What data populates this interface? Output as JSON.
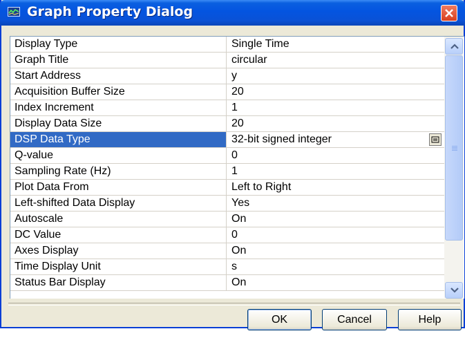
{
  "window": {
    "title": "Graph Property Dialog",
    "close_icon": "close-icon"
  },
  "properties": [
    {
      "name": "Display Type",
      "value": "Single Time"
    },
    {
      "name": "Graph Title",
      "value": "circular"
    },
    {
      "name": "Start Address",
      "value": "y"
    },
    {
      "name": "Acquisition Buffer Size",
      "value": "20"
    },
    {
      "name": "Index Increment",
      "value": "1"
    },
    {
      "name": "Display Data Size",
      "value": "20"
    },
    {
      "name": "DSP Data Type",
      "value": "32-bit signed integer",
      "selected": true
    },
    {
      "name": "Q-value",
      "value": "0"
    },
    {
      "name": "Sampling Rate (Hz)",
      "value": "1"
    },
    {
      "name": "Plot Data From",
      "value": "Left to Right"
    },
    {
      "name": "Left-shifted Data Display",
      "value": "Yes"
    },
    {
      "name": "Autoscale",
      "value": "On"
    },
    {
      "name": "DC Value",
      "value": "0"
    },
    {
      "name": "Axes Display",
      "value": "On"
    },
    {
      "name": "Time Display Unit",
      "value": "s"
    },
    {
      "name": "Status Bar Display",
      "value": "On"
    }
  ],
  "buttons": {
    "ok": "OK",
    "cancel": "Cancel",
    "help": "Help"
  },
  "colors": {
    "titlebar": "#0454e0",
    "selection": "#316ac5",
    "close": "#d8401f"
  }
}
